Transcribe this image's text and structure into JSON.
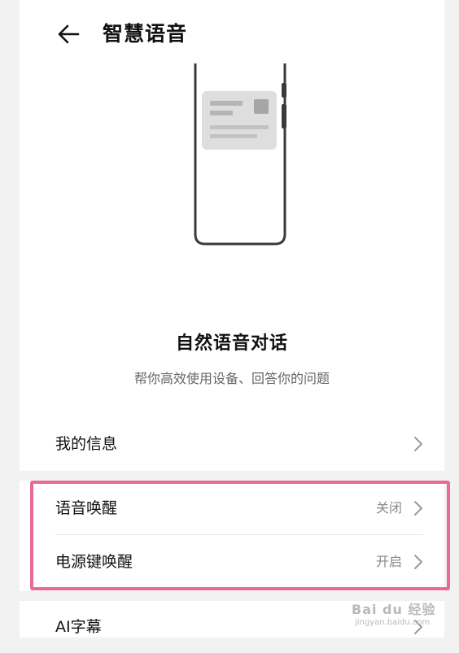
{
  "header": {
    "title": "智慧语音",
    "back_icon": "arrow-left-icon"
  },
  "hero": {
    "illustration_icon": "phone-card-illustration",
    "title": "自然语音对话",
    "subtitle": "帮你高效使用设备、回答你的问题"
  },
  "settings": {
    "my_info": {
      "label": "我的信息",
      "chevron_icon": "chevron-right-icon"
    },
    "voice_wake": {
      "label": "语音唤醒",
      "value": "关闭",
      "chevron_icon": "chevron-right-icon"
    },
    "power_key_wake": {
      "label": "电源键唤醒",
      "value": "开启",
      "chevron_icon": "chevron-right-icon"
    },
    "ai_subtitles": {
      "label": "AI字幕",
      "chevron_icon": "chevron-right-icon"
    }
  },
  "annotation": {
    "highlight_color": "#e8699a"
  },
  "watermark": {
    "main": "Bai du 经验",
    "sub": "jingyan.baidu.com"
  },
  "colors": {
    "page_bg": "#f2f2f2",
    "card_bg": "#ffffff",
    "secondary_text": "#888888"
  }
}
